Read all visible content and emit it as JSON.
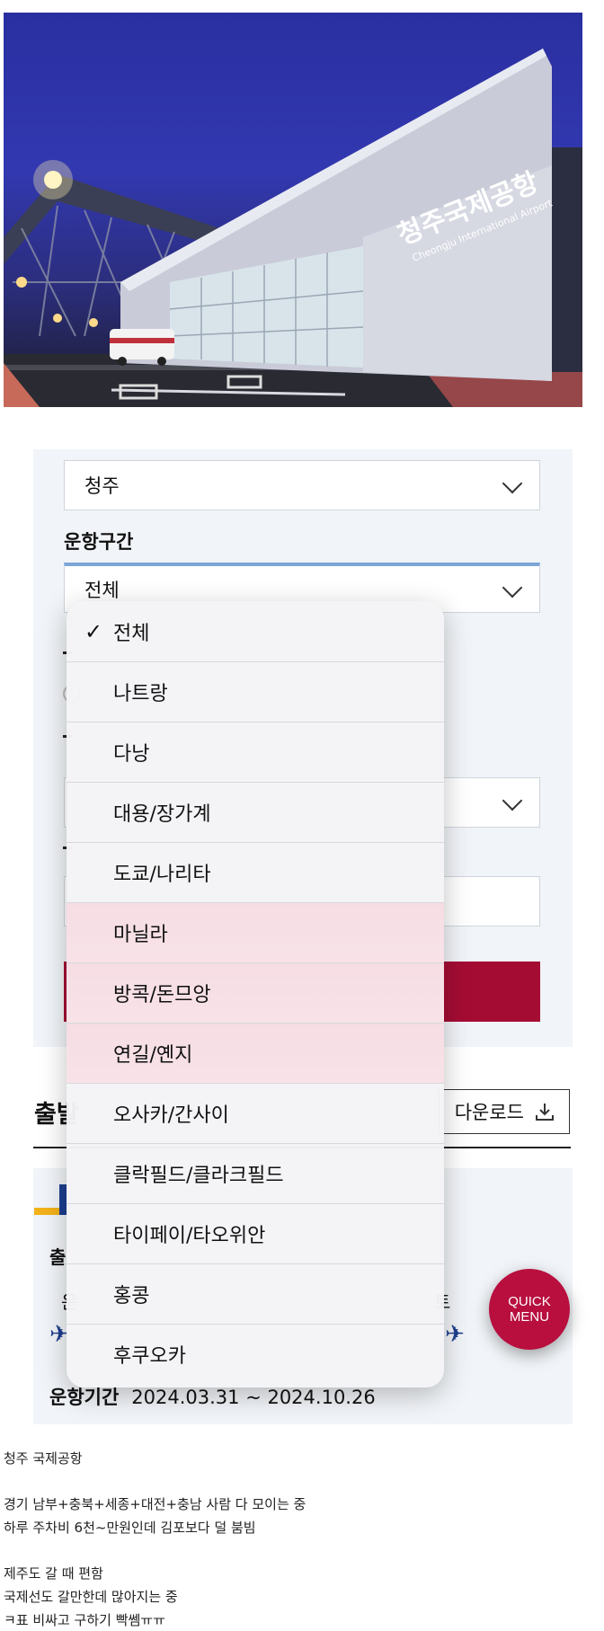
{
  "hero": {
    "sign_korean": "청주국제공항",
    "sign_english": "Cheongju International Airport"
  },
  "form": {
    "airport_value": "청주",
    "route_label": "운항구간",
    "route_value": "전체"
  },
  "dropdown": {
    "selected": "전체",
    "check_mark": "✓",
    "options": [
      "전체",
      "나트랑",
      "다낭",
      "대용/장가계",
      "도쿄/나리타",
      "마닐라",
      "방콕/돈므앙",
      "연길/옌지",
      "오사카/간사이",
      "클락필드/클라크필드",
      "타이페이/타오위안",
      "홍콩",
      "후쿠오카"
    ]
  },
  "timetable": {
    "title_visible": "출발",
    "download_label": "다운로드",
    "card_partial": "출",
    "partial_a": "운",
    "weekday_partial": "토",
    "period_label": "운항기간",
    "period_value": "2024.03.31 ~ 2024.10.26"
  },
  "quick_menu": {
    "line1": "QUICK",
    "line2": "MENU"
  },
  "post": {
    "lines": [
      "청주 국제공항",
      "경기 남부+충북+세종+대전+충남 사람 다 모이는 중",
      "하루 주차비 6천~만원인데 김포보다 덜 붐빔",
      "제주도 갈 때 편함",
      "국제선도 갈만한데 많아지는 중",
      "ㅋ표 비싸고 구하기 빡쎔ㅠㅠ"
    ]
  },
  "colors": {
    "accent": "#a50c34",
    "quick_menu": "#b80f3f",
    "brand_blue": "#1d3f8f",
    "brand_yellow": "#f3b21b",
    "panel_bg": "#f1f4f8"
  }
}
